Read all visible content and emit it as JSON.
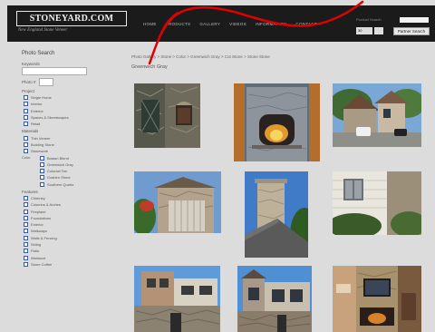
{
  "header": {
    "logo_text": "STONEYARD.COM",
    "tagline": "New England Stone Veneer",
    "nav": [
      "HOME",
      "PRODUCTS",
      "GALLERY",
      "VIDEOS",
      "INFORMATION",
      "CONTACT"
    ],
    "search_label": "Product Search",
    "search_select": "30",
    "search_button": "Partner Search"
  },
  "sidebar": {
    "title": "Photo Search",
    "keywords_label": "Keywords",
    "photo_label": "Photo #",
    "groups": [
      {
        "label": "Project",
        "items": [
          "Single Home",
          "Interior",
          "Exterior",
          "Spaces & Streetscapes",
          "Retail"
        ]
      },
      {
        "label": "Materials",
        "items": [
          "Thin Veneer",
          "Building Stone",
          "Stonework"
        ]
      }
    ],
    "color_label": "Color",
    "colors": [
      "Boston Blend",
      "Greenwich Gray",
      "Colonial Tan",
      "Goshen Stone",
      "Southern Quartz"
    ],
    "features_label": "Features",
    "features": [
      "Chimney",
      "Columns & Arches",
      "Fireplace",
      "Foundations",
      "Exterior",
      "Walkways",
      "Walls & Fencing",
      "Siding",
      "Patio",
      "Wainscot",
      "Stone Coffee"
    ]
  },
  "content": {
    "breadcrumb": "Photo Gallery > Stone > Color > Greenwich Gray > Cut Stone > Stone Stone",
    "title": "Greenwich Gray"
  },
  "colors": {
    "header_bg": "#1b1b1b",
    "page_bg": "#dcdcdc",
    "checkbox": "#3a5ba0",
    "pen": "#e00000"
  },
  "thumbnails": [
    {
      "name": "stone-window-wall"
    },
    {
      "name": "stone-fireplace"
    },
    {
      "name": "stone-house-exterior"
    },
    {
      "name": "stone-garage-gate"
    },
    {
      "name": "stone-chimney"
    },
    {
      "name": "stone-window-siding"
    },
    {
      "name": "townhouse-stone-base"
    },
    {
      "name": "stone-tower-facade"
    },
    {
      "name": "interior-stone-fireplace"
    }
  ]
}
